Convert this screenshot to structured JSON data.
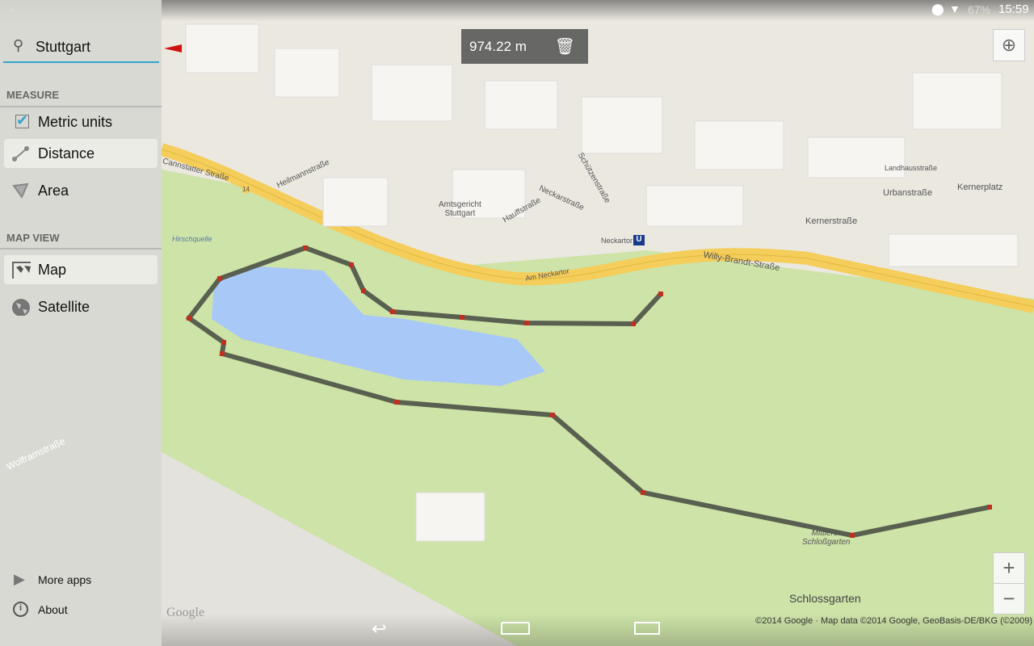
{
  "status": {
    "battery": "67%",
    "time": "15:59"
  },
  "search": {
    "value": "Stuttgart"
  },
  "sidebar": {
    "measure_header": "MEASURE",
    "metric_units": {
      "label": "Metric units",
      "checked": true
    },
    "distance": "Distance",
    "area": "Area",
    "mapview_header": "MAP VIEW",
    "map": "Map",
    "satellite": "Satellite",
    "more_apps": "More apps",
    "about": "About"
  },
  "measurement": {
    "distance": "974.22 m"
  },
  "zoom": {
    "in": "+",
    "out": "−"
  },
  "map_labels": {
    "cannstatter": "Cannstatter Straße",
    "heilmann": "Heilmannstraße",
    "amtsgericht": "Amtsgericht\nStuttgart",
    "hauff": "Hauffstraße",
    "neckar": "Neckarstraße",
    "schuetzen": "Schützenstraße",
    "neckartor": "Neckartor",
    "willy": "Willy-Brandt-Straße",
    "am_neckartor": "Am Neckartor",
    "urban": "Urbanstraße",
    "kernerplatz": "Kernerplatz",
    "landhaus": "Landhausstraße",
    "kerner": "Kernerstraße",
    "hirschquelle": "Hirschquelle",
    "mittlerer": "Mittlerer\nSchloßgarten",
    "schlossgarten": "Schlossgarten",
    "wolfram": "Wolframstraße",
    "road_number": "14",
    "ubahn": "U"
  },
  "google_logo": "Google",
  "attribution": "©2014 Google · Map data ©2014 Google, GeoBasis-DE/BKG (©2009)",
  "colors": {
    "accent": "#33a3d0",
    "park": "#cde3a8",
    "water": "#a8c8f8",
    "road": "#f5cd5a",
    "path": "#5a6050"
  }
}
